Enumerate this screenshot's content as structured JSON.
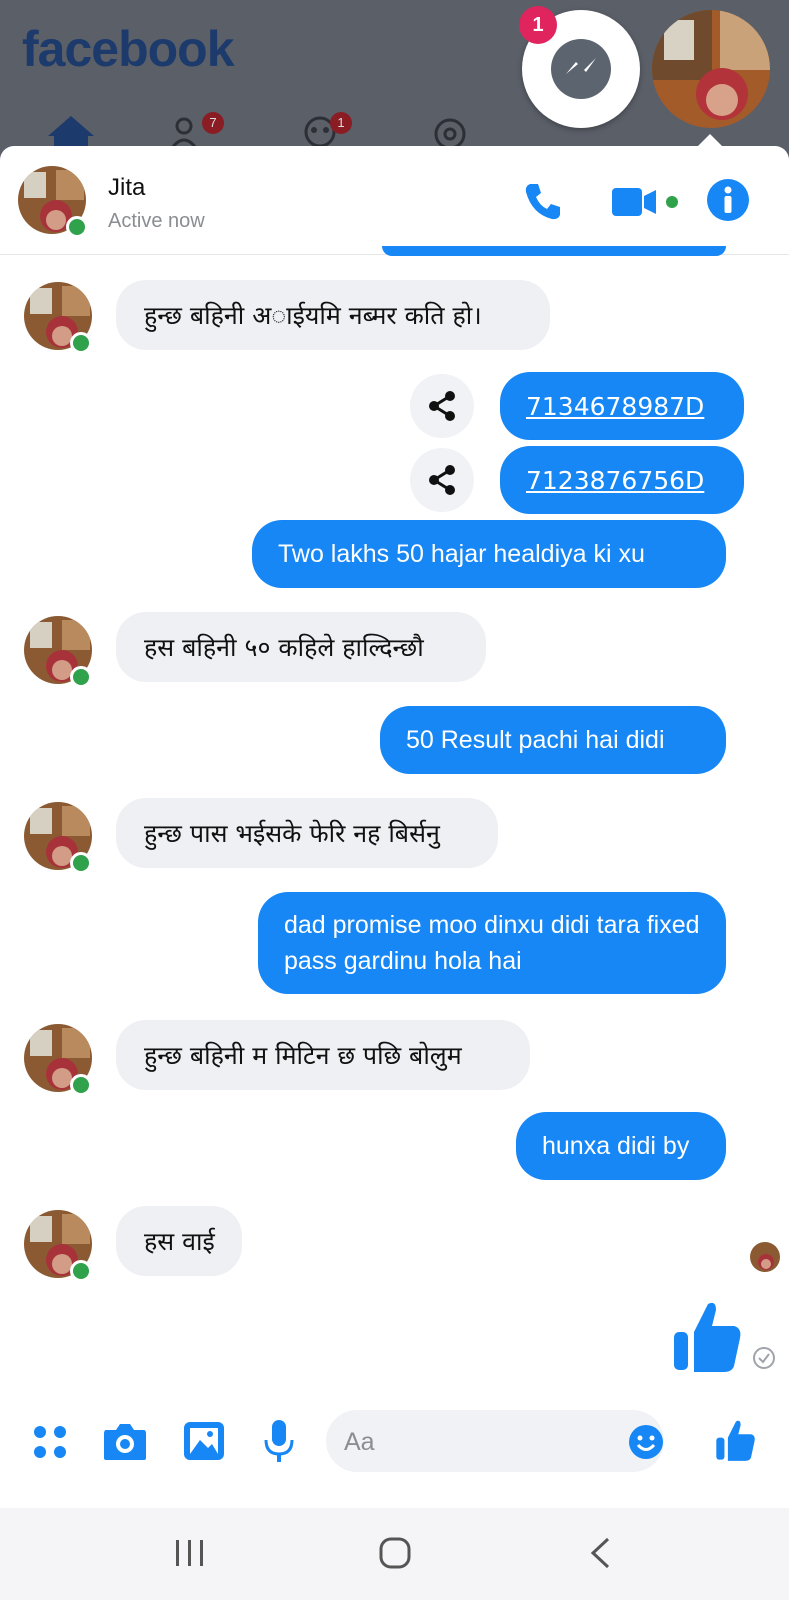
{
  "background": {
    "app_logo": "facebook",
    "nav_badges": [
      "7",
      "1"
    ],
    "messenger_badge": "1"
  },
  "chat": {
    "contact_name": "Jita",
    "status": "Active now",
    "header_icons": [
      "phone-icon",
      "video-camera-icon",
      "info-icon"
    ]
  },
  "messages": [
    {
      "dir": "in",
      "text": "हुन्छ बहिनी अाईयमि नब्मर कति हो।"
    },
    {
      "dir": "out",
      "text": "7134678987D",
      "link": true
    },
    {
      "dir": "out",
      "text": "7123876756D",
      "link": true
    },
    {
      "dir": "out",
      "text": "Two lakhs 50 hajar healdiya ki xu"
    },
    {
      "dir": "in",
      "text": "हस बहिनी ५० कहिले हाल्दिन्छौ"
    },
    {
      "dir": "out",
      "text": "50 Result pachi hai didi"
    },
    {
      "dir": "in",
      "text": "हुन्छ पास भईसके फेरि नह बिर्सनु"
    },
    {
      "dir": "out",
      "text": "dad promise moo dinxu didi tara fixed pass gardinu hola hai"
    },
    {
      "dir": "in",
      "text": "हुन्छ बहिनी म मिटिन छ पछि बोलुम"
    },
    {
      "dir": "out",
      "text": "hunxa didi by"
    },
    {
      "dir": "in",
      "text": "हस वाई"
    }
  ],
  "composer": {
    "placeholder": "Aa",
    "icons": [
      "menu-dots-icon",
      "camera-icon",
      "gallery-icon",
      "microphone-icon",
      "emoji-icon",
      "like-icon"
    ]
  },
  "android_nav": [
    "recents-icon",
    "home-icon",
    "back-icon"
  ],
  "colors": {
    "accent": "#1787f5",
    "incoming_bubble": "#eef0f3",
    "online": "#31a24c",
    "badge": "#e0245e"
  }
}
